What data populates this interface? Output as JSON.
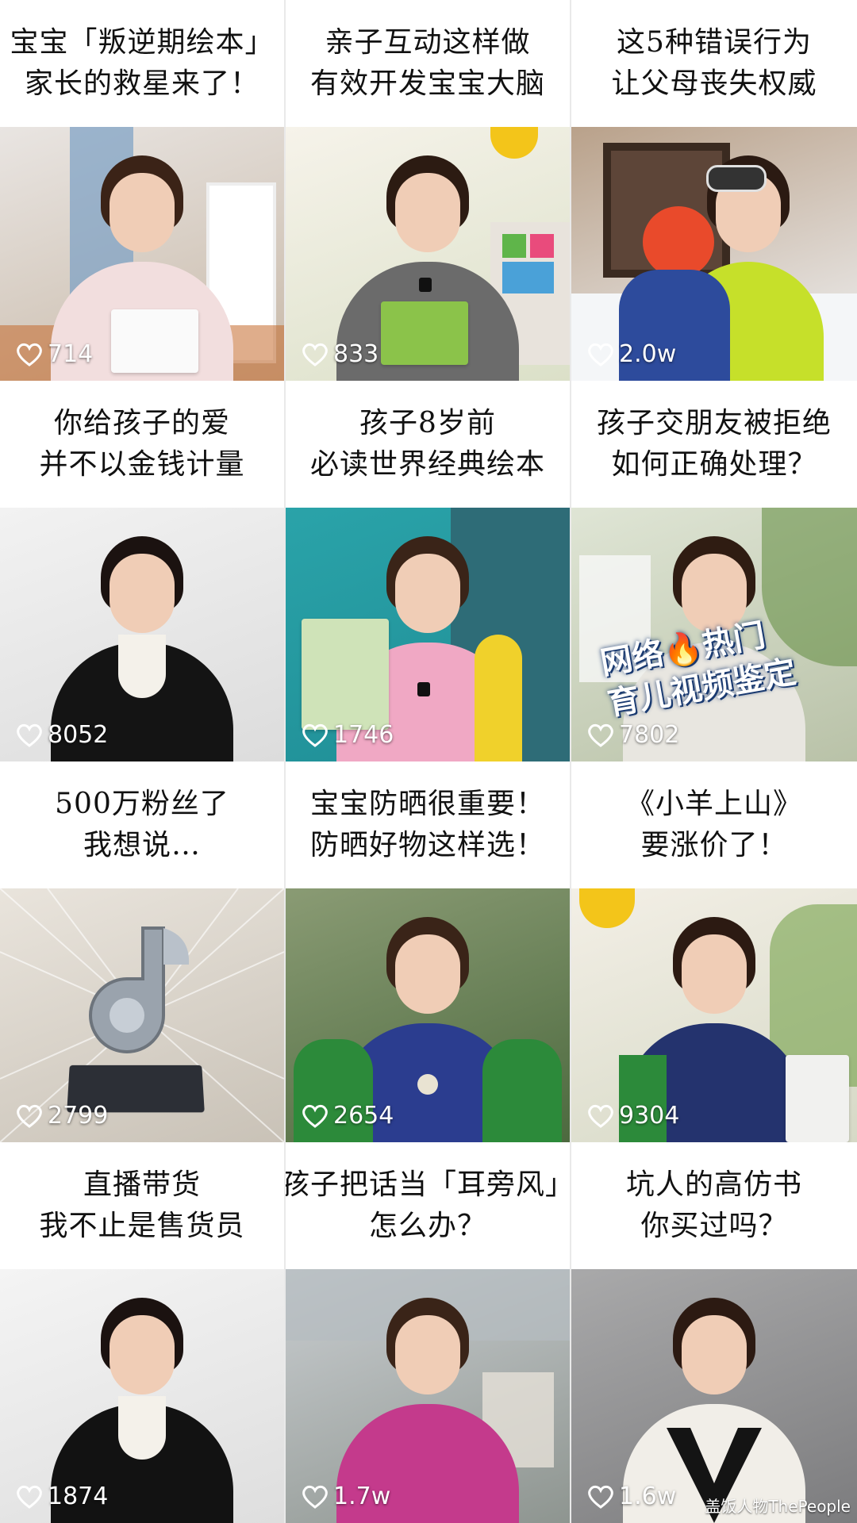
{
  "cards": [
    {
      "title_line1": "宝宝「叛逆期绘本」",
      "title_line2": "家长的救星来了！",
      "likes": "714"
    },
    {
      "title_line1": "亲子互动这样做",
      "title_line2": "有效开发宝宝大脑",
      "likes": "833"
    },
    {
      "title_line1": "这5种错误行为",
      "title_line2": "让父母丧失权威",
      "likes": "2.0w"
    },
    {
      "title_line1": "你给孩子的爱",
      "title_line2": "并不以金钱计量",
      "likes": "8052"
    },
    {
      "title_line1": "孩子8岁前",
      "title_line2": "必读世界经典绘本",
      "likes": "1746"
    },
    {
      "title_line1": "孩子交朋友被拒绝",
      "title_line2": "如何正确处理？",
      "likes": "7802",
      "overlay_line1": "网络",
      "overlay_line2": "热门",
      "overlay_line3": "育儿视频鉴定"
    },
    {
      "title_line1": "500万粉丝了",
      "title_line2": "我想说…",
      "likes": "2799"
    },
    {
      "title_line1": "宝宝防晒很重要！",
      "title_line2": "防晒好物这样选！",
      "likes": "2654"
    },
    {
      "title_line1": "《小羊上山》",
      "title_line2": "要涨价了！",
      "likes": "9304"
    },
    {
      "title_line1": "直播带货",
      "title_line2": "我不止是售货员",
      "likes": "1874"
    },
    {
      "title_line1": "孩子把话当「耳旁风」",
      "title_line2": "怎么办？",
      "likes": "1.7w"
    },
    {
      "title_line1": "坑人的高仿书",
      "title_line2": "你买过吗？",
      "likes": "1.6w"
    }
  ],
  "watermark": "盖饭人物ThePeople",
  "colors": {
    "title_text": "#111111",
    "likes_text": "#ffffff",
    "divider": "#e9e9e9",
    "fire": "#ff6a00"
  },
  "icons": {
    "like": "heart-outline-icon",
    "overlay": "fire-icon"
  }
}
